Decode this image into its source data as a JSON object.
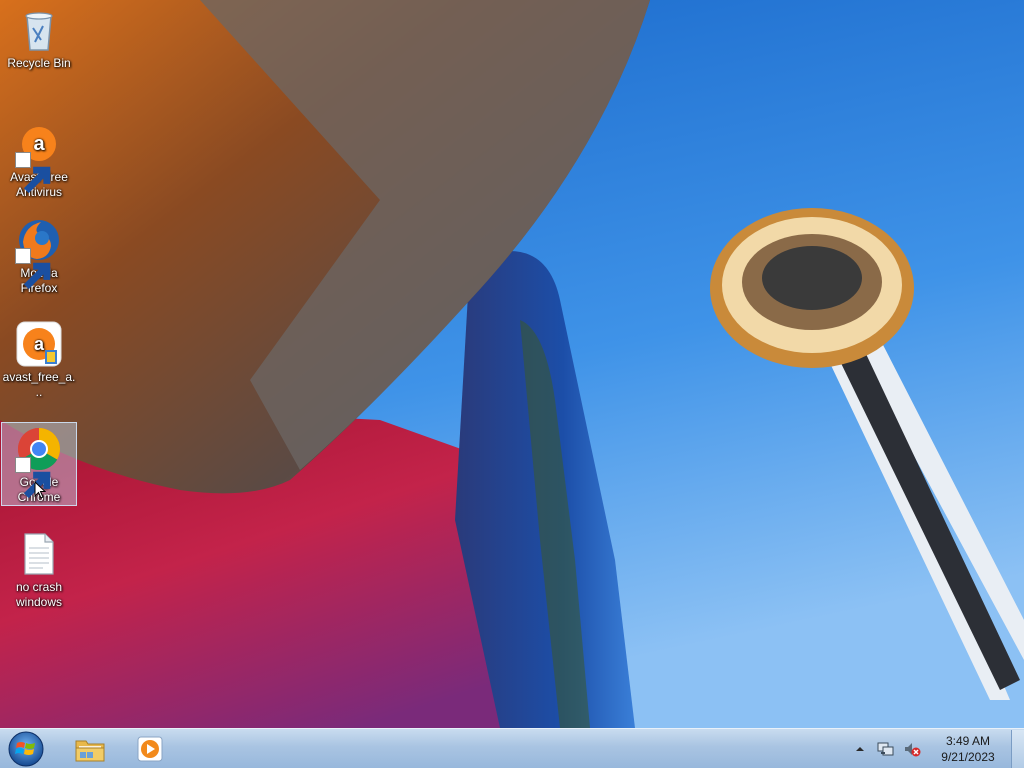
{
  "desktop": {
    "icons": [
      {
        "label": "Recycle Bin",
        "icon": "recycle-bin-icon",
        "shortcut": false
      },
      {
        "label": "Avast Free Antivirus",
        "icon": "avast-icon",
        "shortcut": true
      },
      {
        "label": "Mozilla Firefox",
        "icon": "firefox-icon",
        "shortcut": true
      },
      {
        "label": "avast_free_a...",
        "icon": "avast-installer-icon",
        "shortcut": false
      },
      {
        "label": "Google Chrome",
        "icon": "chrome-icon",
        "shortcut": true,
        "selected": true
      },
      {
        "label": "no crash windows",
        "icon": "text-file-icon",
        "shortcut": false
      }
    ]
  },
  "taskbar": {
    "start": {
      "icon": "windows-start-icon"
    },
    "pinned": [
      {
        "name": "Windows Explorer",
        "icon": "folder-icon"
      },
      {
        "name": "Windows Media Player",
        "icon": "media-player-icon"
      }
    ],
    "tray": {
      "icons": [
        "show-hidden-icons-chevron",
        "network-icon",
        "volume-muted-icon"
      ],
      "time": "3:49 AM",
      "date": "9/21/2023"
    }
  },
  "colors": {
    "sky": "#2f86e0",
    "taskbar": "#a9c4e2",
    "selection": "#bed7f0"
  }
}
